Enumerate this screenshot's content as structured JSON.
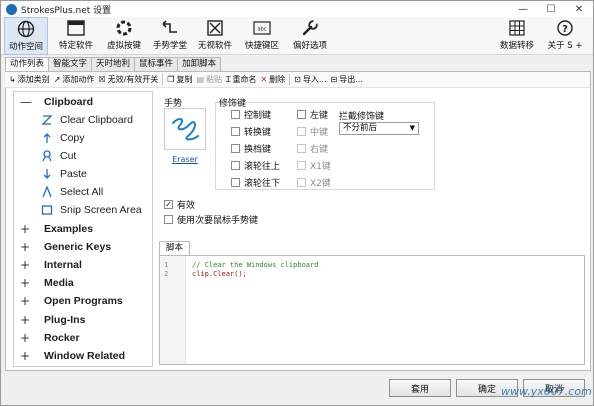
{
  "window": {
    "title": "StrokesPlus.net 设置",
    "min": "—",
    "max": "☐",
    "close": "✕"
  },
  "toolbar": {
    "items": [
      {
        "label": "动作空间",
        "icon": "globe-icon"
      },
      {
        "label": "特定软件",
        "icon": "window-icon"
      },
      {
        "label": "虚拟按键",
        "icon": "circle-dots-icon"
      },
      {
        "label": "手势学堂",
        "icon": "return-arrow-icon"
      },
      {
        "label": "无视软件",
        "icon": "crossed-box-icon"
      },
      {
        "label": "快捷键区",
        "icon": "keyboard-icon"
      },
      {
        "label": "偏好选项",
        "icon": "wrench-icon"
      }
    ],
    "right_items": [
      {
        "label": "数据转移",
        "icon": "grid-icon"
      },
      {
        "label": "关于 S +",
        "icon": "question-icon"
      }
    ]
  },
  "tabs": [
    "动作列表",
    "智能文字",
    "天时地利",
    "鼠标事件",
    "加卸脚本"
  ],
  "actions": {
    "add_category": "添加类别",
    "add_action": "添加动作",
    "toggle": "无效/有效开关",
    "copy": "复制",
    "paste": "粘贴",
    "rename": "重命名",
    "delete": "删除",
    "import": "导入...",
    "export": "导出..."
  },
  "tree": {
    "clipboard": "Clipboard",
    "children": [
      "Clear Clipboard",
      "Copy",
      "Cut",
      "Paste",
      "Select All",
      "Snip Screen Area"
    ],
    "categories": [
      "Examples",
      "Generic Keys",
      "Internal",
      "Media",
      "Open Programs",
      "Plug-Ins",
      "Rocker",
      "Window Related"
    ]
  },
  "gesture": {
    "label": "手势",
    "name": "Eraser"
  },
  "modifiers": {
    "label": "修饰键",
    "left_col": [
      "控制键",
      "转换键",
      "换档键",
      "滚轮往上",
      "滚轮往下"
    ],
    "mid_col": [
      "左键",
      "中键",
      "右键",
      "X1键",
      "X2键"
    ],
    "intercept_label": "拦截修饰键",
    "intercept_value": "不分前后"
  },
  "options": {
    "enabled": "有效",
    "secondary": "使用次要鼠标手势键"
  },
  "script": {
    "tab": "脚本",
    "lines": [
      {
        "n": "1",
        "text": "// Clear the Windows clipboard"
      },
      {
        "n": "2",
        "text": "clip.Clear();"
      }
    ]
  },
  "buttons": {
    "apply": "套用",
    "ok": "确定",
    "cancel": "取消"
  },
  "watermark": "www.yx007.com"
}
